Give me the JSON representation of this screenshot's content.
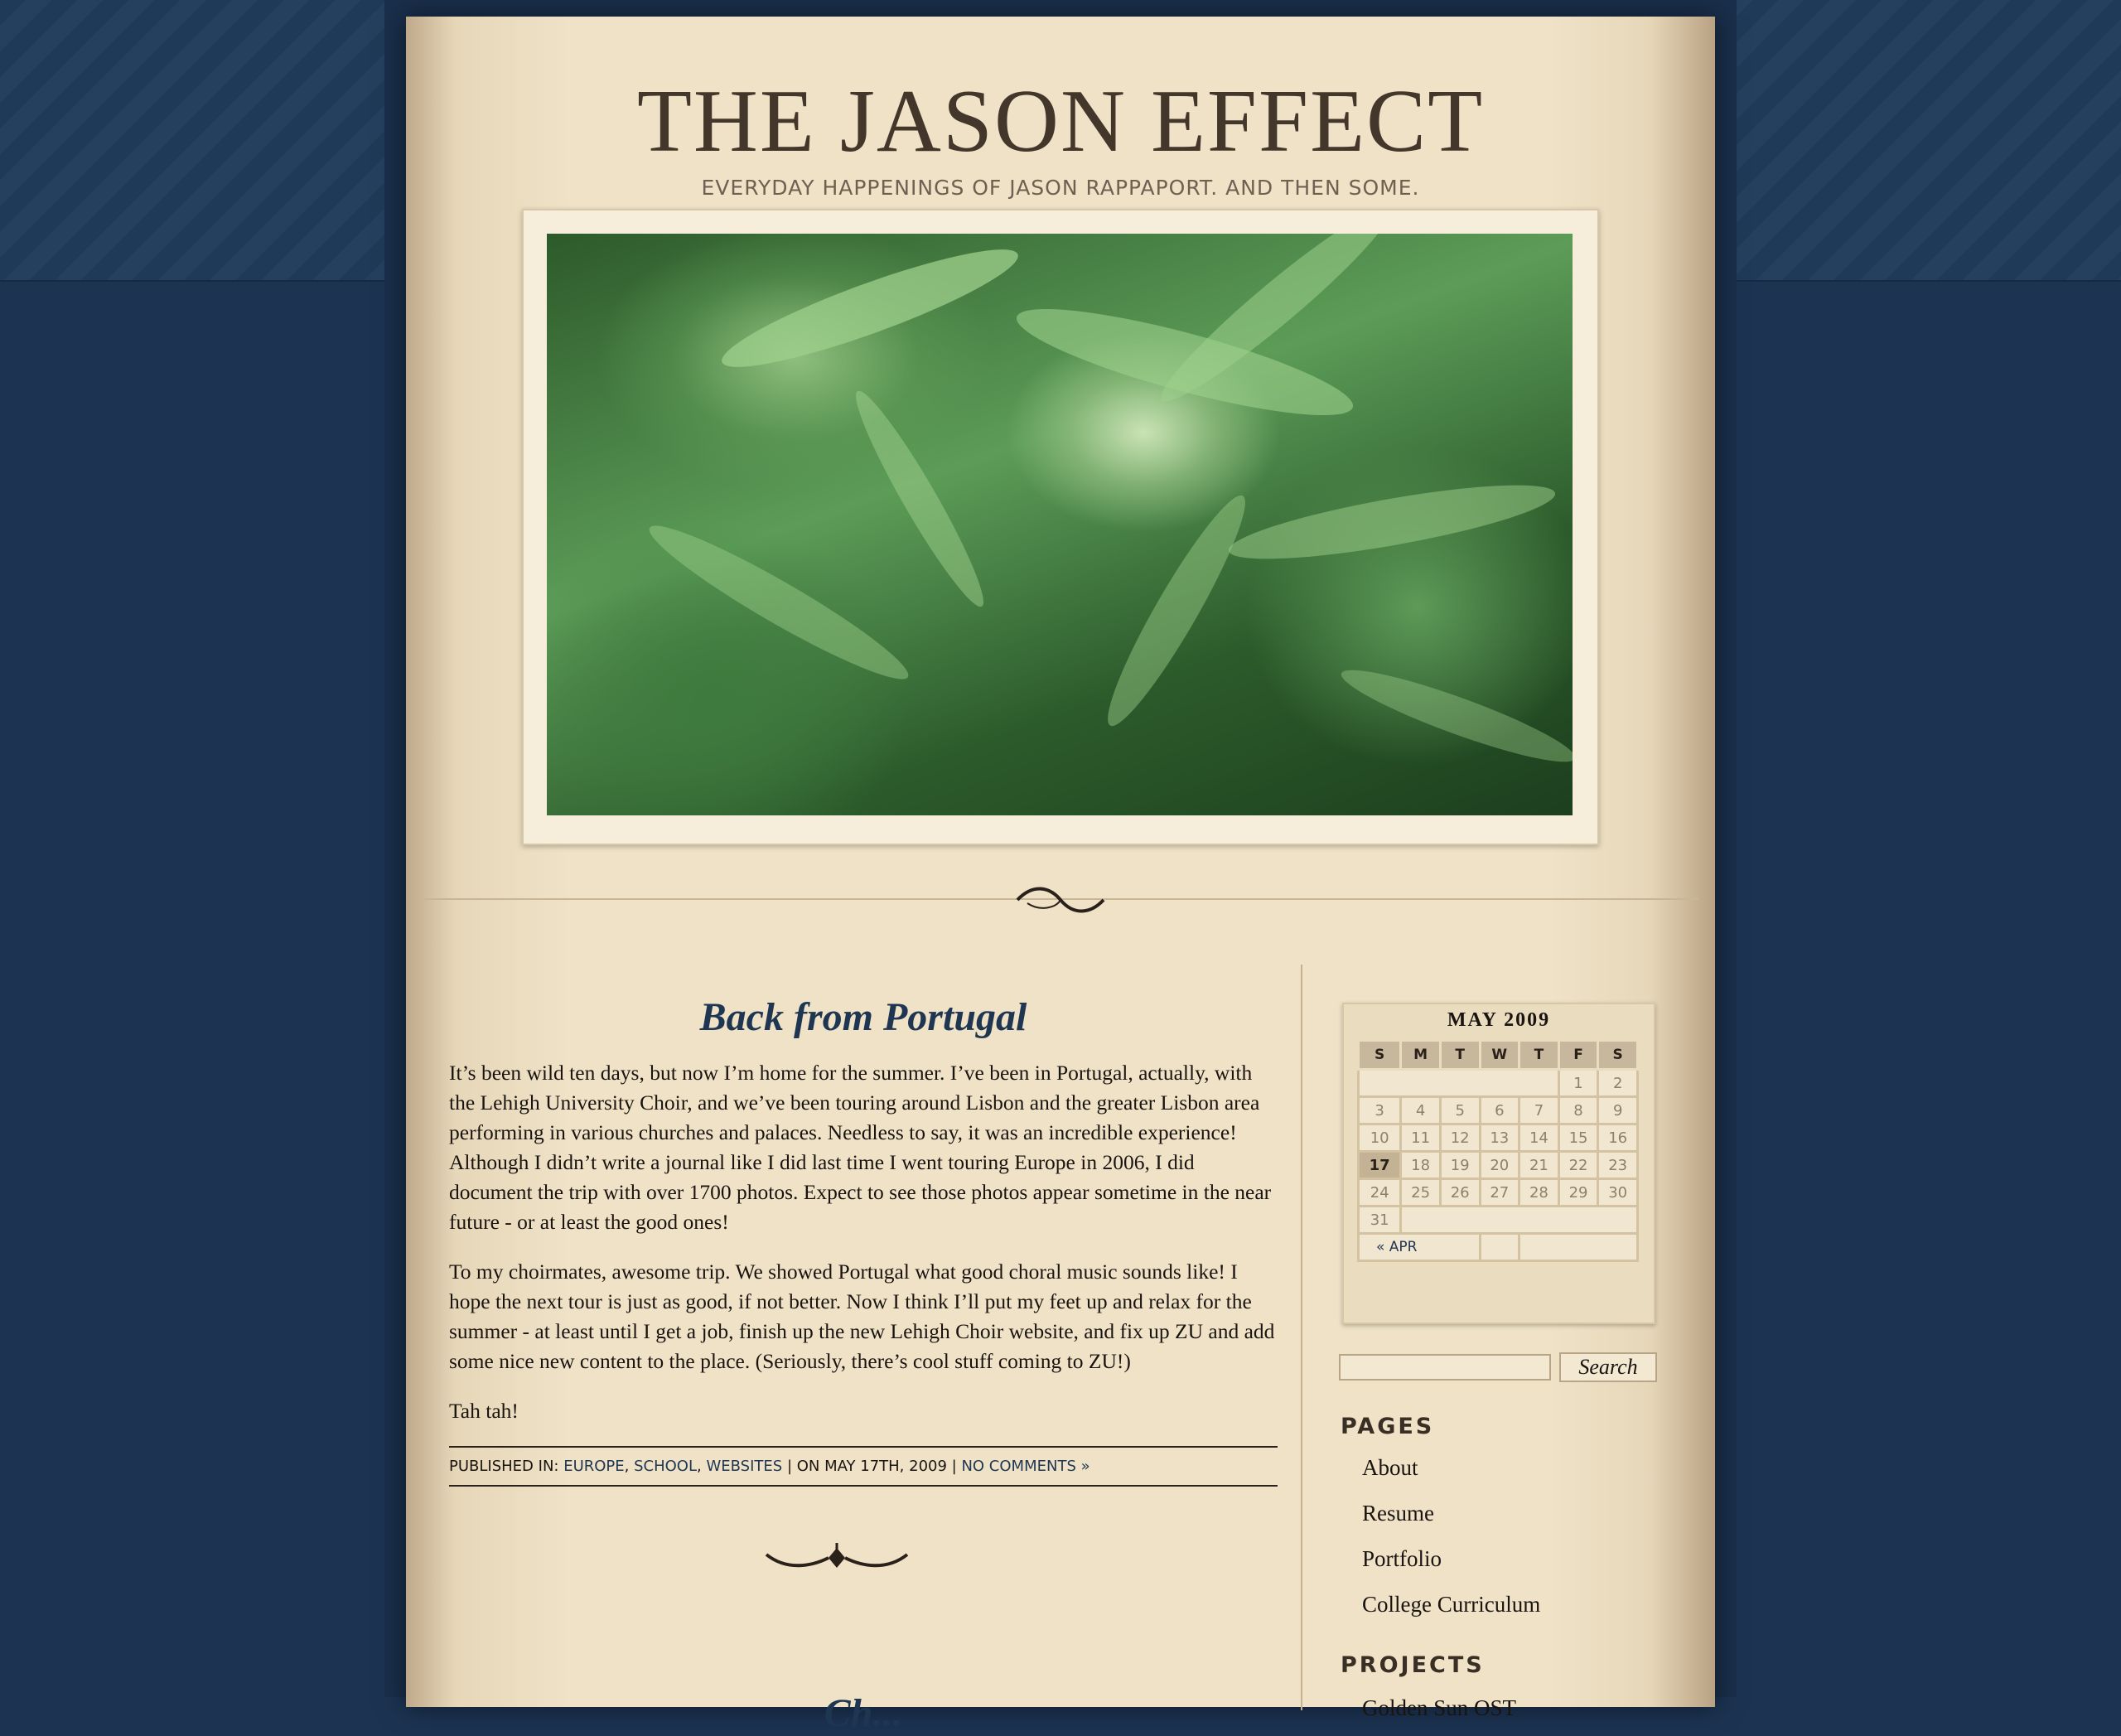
{
  "site": {
    "title": "THE JASON EFFECT",
    "tagline": "EVERYDAY HAPPENINGS OF JASON RAPPAPORT. AND THEN SOME."
  },
  "post": {
    "title": "Back from Portugal",
    "paragraphs": [
      "It’s been wild ten days, but now I’m home for the summer. I’ve been in Portugal, actually, with the Lehigh University Choir, and we’ve been touring around Lisbon and the greater Lisbon area performing in various churches and palaces. Needless to say, it was an incredible experience! Although I didn’t write a journal like I did last time I went touring Europe in 2006, I did document the trip with over 1700 photos. Expect to see those photos appear sometime in the near future - or at least the good ones!",
      "To my choirmates, awesome trip. We showed Portugal what good choral music sounds like! I hope the next tour is just as good, if not better. Now I think I’ll put my feet up and relax for the summer - at least until I get a job, finish up the new Lehigh Choir website, and fix up ZU and add some nice new content to the place. (Seriously, there’s cool stuff coming to ZU!)",
      "Tah tah!"
    ],
    "meta": {
      "published_label": "PUBLISHED IN:",
      "categories": [
        "EUROPE",
        "SCHOOL",
        "WEBSITES"
      ],
      "date_text": "| ON MAY 17TH, 2009 |",
      "comments": "NO COMMENTS »"
    }
  },
  "next_post": {
    "title": "Ch..."
  },
  "calendar": {
    "caption": "MAY 2009",
    "weekdays": [
      "S",
      "M",
      "T",
      "W",
      "T",
      "F",
      "S"
    ],
    "weeks": [
      [
        "",
        "",
        "",
        "",
        "",
        "1",
        "2"
      ],
      [
        "3",
        "4",
        "5",
        "6",
        "7",
        "8",
        "9"
      ],
      [
        "10",
        "11",
        "12",
        "13",
        "14",
        "15",
        "16"
      ],
      [
        "17",
        "18",
        "19",
        "20",
        "21",
        "22",
        "23"
      ],
      [
        "24",
        "25",
        "26",
        "27",
        "28",
        "29",
        "30"
      ],
      [
        "31",
        "",
        "",
        "",
        "",
        "",
        ""
      ]
    ],
    "prev_link": "« APR",
    "today": "17"
  },
  "search": {
    "button_label": "Search",
    "placeholder": ""
  },
  "sidebar": {
    "pages_heading": "PAGES",
    "pages": [
      "About",
      "Resume",
      "Portfolio",
      "College Curriculum"
    ],
    "projects_heading": "PROJECTS",
    "projects_first": "Golden Sun OST"
  },
  "colors": {
    "background": "#1c3352",
    "paper": "#efe2c7",
    "title_text": "#43362a",
    "link": "#1f3652"
  }
}
